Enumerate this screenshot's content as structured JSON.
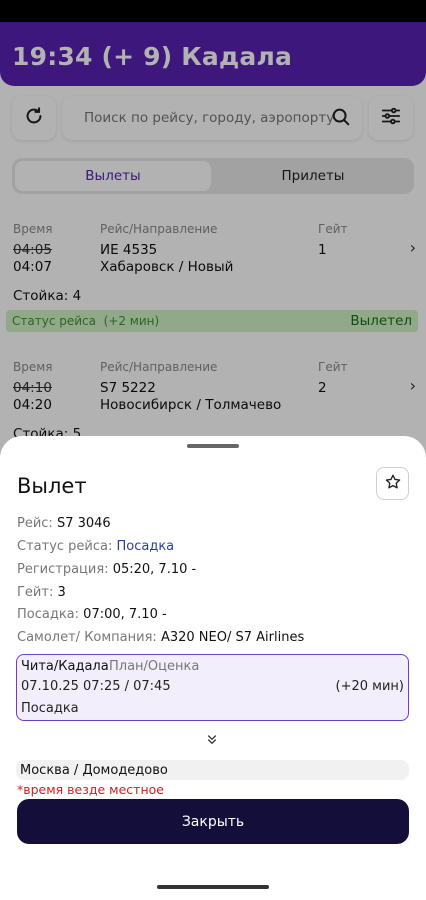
{
  "header": {
    "title": "19:34 (+ 9) Кадала"
  },
  "toolbar": {
    "refresh_icon": "refresh-icon",
    "search_placeholder": "Поиск по рейсу, городу, аэропорту...",
    "search_icon": "search-icon",
    "filter_icon": "sliders-icon"
  },
  "tabs": [
    {
      "label": "Вылеты",
      "active": true
    },
    {
      "label": "Прилеты",
      "active": false
    }
  ],
  "columns": {
    "time": "Время",
    "flight": "Рейс/Направление",
    "gate": "Гейт"
  },
  "flights": [
    {
      "time_scheduled": "04:05",
      "time_actual": "04:07",
      "flight_no": "ИЕ 4535",
      "destination": "Хабаровск / Новый",
      "gate": "1",
      "counter": "Стойка: 4",
      "status_label": "Статус рейса",
      "status_delay": "(+2 мин)",
      "status_value": "Вылетел"
    },
    {
      "time_scheduled": "04:10",
      "time_actual": "04:20",
      "flight_no": "S7 5222",
      "destination": "Новосибирск / Толмачево",
      "gate": "2",
      "counter": "Стойка: 5"
    }
  ],
  "sheet": {
    "title": "Вылет",
    "favorite_icon": "star-icon",
    "rows": [
      {
        "key": "Рейс:",
        "value": "S7 3046"
      },
      {
        "key": "Статус рейса:",
        "value": "Посадка",
        "link": true
      },
      {
        "key": "Регистрация:",
        "value": "05:20, 7.10 -"
      },
      {
        "key": "Гейт:",
        "value": "3"
      },
      {
        "key": "Посадка:",
        "value": "07:00, 7.10 -"
      },
      {
        "key": "Самолет/ Компания:",
        "value": "A320 NEO/ S7 Airlines"
      }
    ],
    "route": {
      "origin": "Чита/Кадала",
      "plan_label": "План/Оценка",
      "times": "07.10.25 07:25 / 07:45",
      "delay": "(+20 мин)",
      "stage": "Посадка"
    },
    "expand_icon": "chevrons-down-icon",
    "destination": "Москва / Домодедово",
    "note": "*время везде местное",
    "close_label": "Закрыть"
  },
  "colors": {
    "brand": "#5a22b3",
    "close_button": "#130f3a",
    "status_bg": "#cdf3c4",
    "note": "#d22020"
  }
}
